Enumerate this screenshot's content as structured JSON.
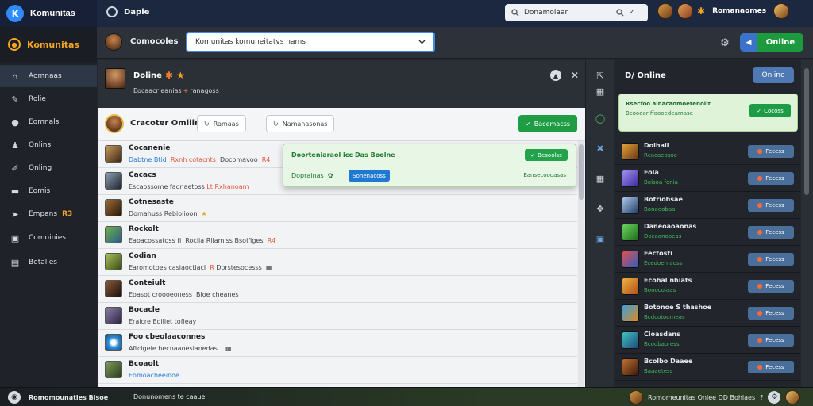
{
  "app": {
    "name": "Komunitas",
    "logo_glyph": "K"
  },
  "page": {
    "title": "Dapie"
  },
  "search": {
    "value": "Donamoiaar",
    "placeholder": ""
  },
  "user": {
    "name": "Romanaomes"
  },
  "sidebar": {
    "header": "Komunitas",
    "items": [
      {
        "label": "Aomnaas",
        "icon": "home-icon",
        "active": true
      },
      {
        "label": "Rolie",
        "icon": "pencil-icon"
      },
      {
        "label": "Eomnals",
        "icon": "chat-icon"
      },
      {
        "label": "Onlins",
        "icon": "users-icon"
      },
      {
        "label": "Onling",
        "icon": "edit-icon"
      },
      {
        "label": "Eomis",
        "icon": "file-icon"
      },
      {
        "label": "Empans",
        "icon": "megaphone-icon",
        "tag": "R3"
      },
      {
        "label": "Comoinies",
        "icon": "id-card-icon"
      },
      {
        "label": "Betalies",
        "icon": "calendar-icon"
      }
    ]
  },
  "subnav": {
    "title": "Comocoles",
    "select_value": "Komunitas komuneitatvs hams",
    "online_label": "Online"
  },
  "main": {
    "profile_name": "Doline",
    "profile_sub_a": "Eocaacr eanias",
    "profile_sub_hl": "+",
    "profile_sub_b": "ranagoss",
    "toolbar_title": "Cracoter Omliins",
    "chip1": "Ramaas",
    "chip2": "Namanasonas",
    "primary_btn": "Bacemacss"
  },
  "rows": [
    {
      "name": "Cocanenie",
      "a": "Dabtne Btid",
      "a_cls": "blue",
      "b": "Rxnh cotacnts",
      "b_cls": "red",
      "c": "Docomavoo",
      "c_cls": "",
      "d": "R4",
      "d_cls": "red"
    },
    {
      "name": "Cacacs",
      "a": "Escaossome faonaetoss",
      "a_cls": "",
      "b": "Lt",
      "b_cls": "red",
      "c": "Rxhanoam",
      "c_cls": "red",
      "d": "",
      "d_cls": ""
    },
    {
      "name": "Cotnesaste",
      "a": "Domahuss Rebiolioon",
      "a_cls": "",
      "b": "",
      "b_cls": "",
      "c": "",
      "c_cls": "",
      "d": "",
      "d_cls": ""
    },
    {
      "name": "Rockolt",
      "a": "Eaoacossatoss fi",
      "a_cls": "",
      "b": "Rociia Rliamiss Bsoifiges",
      "b_cls": "",
      "c": "",
      "c_cls": "",
      "d": "R4",
      "d_cls": "red"
    },
    {
      "name": "Codian",
      "a": "Earomotoes casiaoctiacl",
      "a_cls": "",
      "b": "R",
      "b_cls": "red",
      "c": "Dorstesocesss",
      "c_cls": "",
      "d": "",
      "d_cls": ""
    },
    {
      "name": "Conteiult",
      "a": "Eoasot croooeoness",
      "a_cls": "",
      "b": "Bloe cheanes",
      "b_cls": "",
      "c": "",
      "c_cls": "",
      "d": "",
      "d_cls": ""
    },
    {
      "name": "Bocacle",
      "a": "Eraicre Eoiliet tofieay",
      "a_cls": "",
      "b": "",
      "b_cls": "",
      "c": "",
      "c_cls": "",
      "d": "",
      "d_cls": ""
    },
    {
      "name": "Foo cbeolaaconnes",
      "a": "Aftcigeie becnaaoesianedas",
      "a_cls": "",
      "b": "",
      "b_cls": "",
      "c": "",
      "c_cls": "",
      "d": "",
      "d_cls": ""
    },
    {
      "name": "Bcoaolt",
      "a": "Eomoacheeinoe",
      "a_cls": "blue",
      "b": "",
      "b_cls": "",
      "c": "",
      "c_cls": "",
      "d": "",
      "d_cls": ""
    }
  ],
  "popover": {
    "title": "Doorteniaraol icc Das Boolne",
    "btn1": "Besoolss",
    "label": "Doprainas",
    "btn2": "Sonenacoss",
    "link": "Eansecoooasas"
  },
  "right": {
    "title": "D/ Online",
    "online_btn": "Online",
    "card_l1": "Rsecfoo ainacaomoetenoiit",
    "card_l2": "Bcoooar ffaooedeamase",
    "card_btn": "Cocoss",
    "btn_label": "Fecess",
    "rows": [
      {
        "name": "Dolhall",
        "status": "Rcacaeosoe"
      },
      {
        "name": "Fola",
        "status": "Bolsoa fonia"
      },
      {
        "name": "Botriohsae",
        "status": "Bonaeobaa"
      },
      {
        "name": "Daneoaoaonas",
        "status": "Docaanooeas"
      },
      {
        "name": "Fectosti",
        "status": "Ecedoemaoss"
      },
      {
        "name": "Ecohal nhiats",
        "status": "Bonocoiaas"
      },
      {
        "name": "Botonoe S thashoe",
        "status": "Bcdcotoomeas"
      },
      {
        "name": "Cioasdans",
        "status": "Bcoobaoress"
      },
      {
        "name": "Bcolbo Daaee",
        "status": "Baaaetess"
      }
    ]
  },
  "footer": {
    "left": "Romomounaties Bisoe",
    "mid": "Donunomens te caaue",
    "right": "Romomeunitas Oniee DD Bohlaes"
  },
  "colors": {
    "accent": "#f6a623",
    "primary": "#1f9d45",
    "blue": "#3b8be8",
    "topbar": "#1c2740"
  }
}
